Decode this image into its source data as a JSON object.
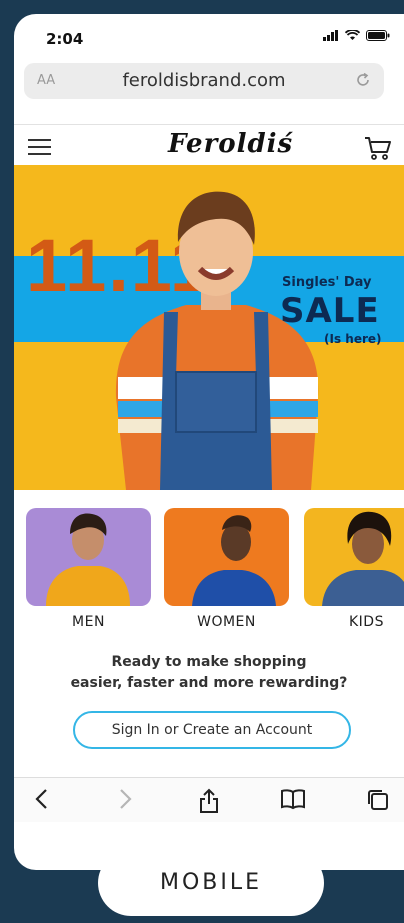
{
  "status_bar": {
    "time": "2:04"
  },
  "browser": {
    "text_size_label": "AA",
    "url": "feroldisbrand.com"
  },
  "site": {
    "logo": "Feroldiś"
  },
  "hero": {
    "number": "11.11",
    "subtitle": "Singles' Day",
    "headline": "SALE",
    "tagline": "(Is here)"
  },
  "categories": [
    {
      "label": "MEN"
    },
    {
      "label": "WOMEN"
    },
    {
      "label": "KIDS"
    }
  ],
  "promo": {
    "line1": "Ready to make shopping",
    "line2": "easier, faster and more rewarding?"
  },
  "signin": {
    "label": "Sign In or Create an Account"
  },
  "footer": {
    "label": "MOBILE"
  },
  "colors": {
    "hero_yellow": "#f5b81c",
    "hero_blue": "#14a6e6",
    "accent_orange": "#d35a15",
    "sale_navy": "#0d2a52",
    "button_border": "#34b6e6",
    "background": "#1b3a52"
  },
  "icons": [
    "signal-icon",
    "wifi-icon",
    "battery-icon",
    "reload-icon",
    "menu-icon",
    "cart-icon",
    "back-icon",
    "forward-icon",
    "share-icon",
    "bookmarks-icon",
    "tabs-icon"
  ]
}
